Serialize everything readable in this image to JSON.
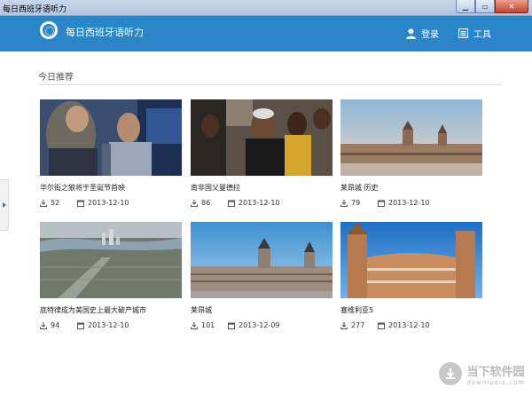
{
  "window": {
    "title": "每日西班牙语听力"
  },
  "header": {
    "app_name": "每日西班牙语听力",
    "login_label": "登录",
    "tools_label": "工具"
  },
  "section": {
    "title": "今日推荐"
  },
  "cards": [
    {
      "title": "华尔街之狼将于圣诞节首映",
      "downloads": "52",
      "date": "2013-12-10"
    },
    {
      "title": "南非国父曼德拉",
      "downloads": "86",
      "date": "2013-12-10"
    },
    {
      "title": "莱昂城·历史",
      "downloads": "79",
      "date": "2013-12-10"
    },
    {
      "title": "底特律成为美国史上最大破产城市",
      "downloads": "94",
      "date": "2013-12-10"
    },
    {
      "title": "莱昂城",
      "downloads": "101",
      "date": "2013-12-09"
    },
    {
      "title": "塞维利亚5",
      "downloads": "277",
      "date": "2013-12-10"
    }
  ],
  "watermark": {
    "cn": "当下软件园",
    "en": "downloxia.com"
  }
}
